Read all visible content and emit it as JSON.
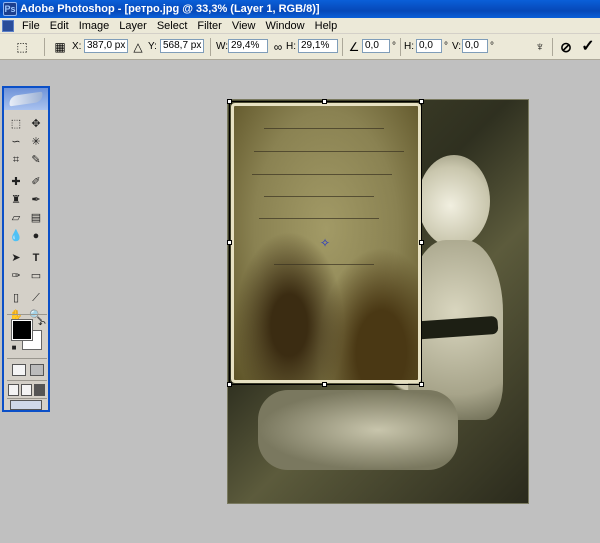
{
  "titlebar": {
    "title": "Adobe Photoshop - [ретро.jpg @ 33,3% (Layer 1, RGB/8)]"
  },
  "menu": {
    "items": [
      "File",
      "Edit",
      "Image",
      "Layer",
      "Select",
      "Filter",
      "View",
      "Window",
      "Help"
    ]
  },
  "options": {
    "x_label": "X:",
    "x_value": "387,0 px",
    "y_label": "Y:",
    "y_value": "568,7 px",
    "w_label": "W:",
    "w_value": "29,4%",
    "h_label": "H:",
    "h_value": "29,1%",
    "angle_value": "0,0",
    "angle_unit": "°",
    "hskew_label": "H:",
    "hskew_value": "0,0",
    "hskew_unit": "°",
    "vskew_label": "V:",
    "vskew_value": "0,0",
    "vskew_unit": "°"
  },
  "icons": {
    "cancel": "cancel-transform-icon",
    "commit": "commit-transform-icon"
  }
}
